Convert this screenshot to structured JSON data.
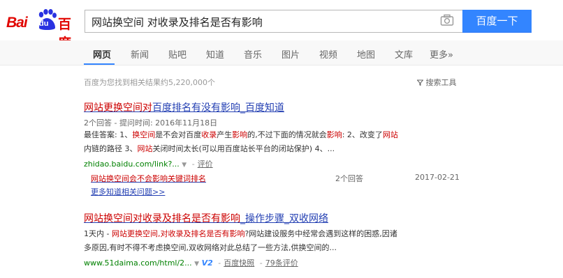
{
  "logo": {
    "text_left": "Bai",
    "text_mid": "du",
    "text_right": "百度",
    "color": "#e10601"
  },
  "search": {
    "query": "网站换空间 对收录及排名是否有影响",
    "button_label": "百度一下",
    "camera_icon": "camera-icon",
    "button_color": "#3385ff"
  },
  "nav": {
    "tabs": [
      "网页",
      "新闻",
      "贴吧",
      "知道",
      "音乐",
      "图片",
      "视频",
      "地图",
      "文库",
      "更多»"
    ],
    "active": "网页"
  },
  "results_info": {
    "count_text": "百度为您找到相关结果约5,220,000个",
    "tools_label": "搜索工具",
    "tools_icon": "filter-icon"
  },
  "results": [
    {
      "title_parts": [
        "网站更换空间对",
        "百度排名有没有影响_百度知道"
      ],
      "meta": "2个回答 - 提问时间: 2016年11月18日",
      "snippet_lines": [
        [
          "最佳答案: 1、",
          "换空间",
          "是不会对百度",
          "收录",
          "产生",
          "影响",
          "的,不过下面的情况就会",
          "影响",
          ": 2、改变了",
          "网站"
        ],
        [
          "内链的路径 3、",
          "网站",
          "关闭时间太长(可以用百度站长平台的闭站保护) 4、..."
        ]
      ],
      "url": "zhidao.baidu.com/link?...",
      "url_extra": "评价",
      "sub": {
        "link_parts": [
          "网站换空间会不会影响关键词",
          "排名"
        ],
        "answers": "2个回答",
        "date": "2017-02-21"
      },
      "more": "更多知道相关问题>>"
    },
    {
      "title_parts": [
        "网站换空间对收录及排名是否有影响",
        "_操作步骤_双收网络"
      ],
      "snippet_lines": [
        [
          "1天内 - ",
          "网站更换空间",
          ",",
          "对收录及排名是否有影响",
          "?网站建设服务中经常会遇到这样的困惑,因诸"
        ],
        [
          "多原因,有时不得不考虑换空间,双收网络对此总结了一些方法,供换空间的..."
        ]
      ],
      "url": "www.51daima.com/html/2...",
      "url_v": "V2",
      "url_snap": "百度快照",
      "url_review": "79条评价"
    }
  ]
}
